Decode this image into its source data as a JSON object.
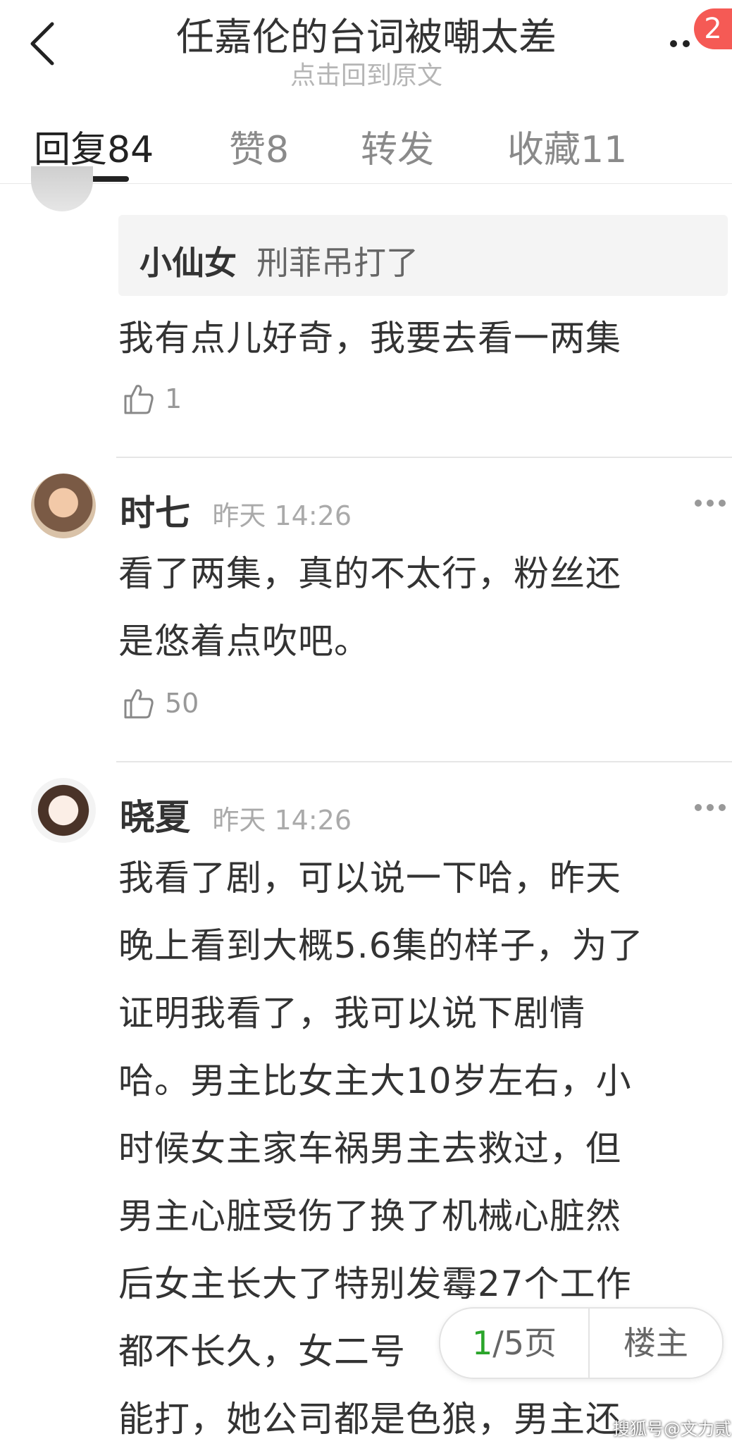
{
  "header": {
    "title": "任嘉伦的台词被嘲太差",
    "subtitle": "点击回到原文",
    "badge": "2"
  },
  "tabs": [
    {
      "label": "回复",
      "count": "84"
    },
    {
      "label": "赞",
      "count": "8"
    },
    {
      "label": "转发",
      "count": ""
    },
    {
      "label": "收藏",
      "count": "11"
    }
  ],
  "comments": [
    {
      "quote_user": "小仙女",
      "quote_text": "刑菲吊打了",
      "lines": [
        "我有点儿好奇，我要去看一两集"
      ],
      "likes": "1"
    },
    {
      "user": "时七",
      "time": "昨天 14:26",
      "lines": [
        "看了两集，真的不太行，粉丝还",
        "是悠着点吹吧。"
      ],
      "likes": "50"
    },
    {
      "user": "晓夏",
      "time": "昨天 14:26",
      "lines": [
        "我看了剧，可以说一下哈，昨天",
        "晚上看到大概5.6集的样子，为了",
        "证明我看了，我可以说下剧情",
        "哈。男主比女主大10岁左右，小",
        "时候女主家车祸男主去救过，但",
        "男主心脏受伤了换了机械心脏然",
        "后女主长大了特别发霉27个工作",
        "都不长久，女二号",
        "能打，她公司都是色狼，男主还"
      ]
    }
  ],
  "pager": {
    "current": "1",
    "total": "/5页",
    "owner": "楼主"
  },
  "watermark": "搜狐号@文力贰"
}
